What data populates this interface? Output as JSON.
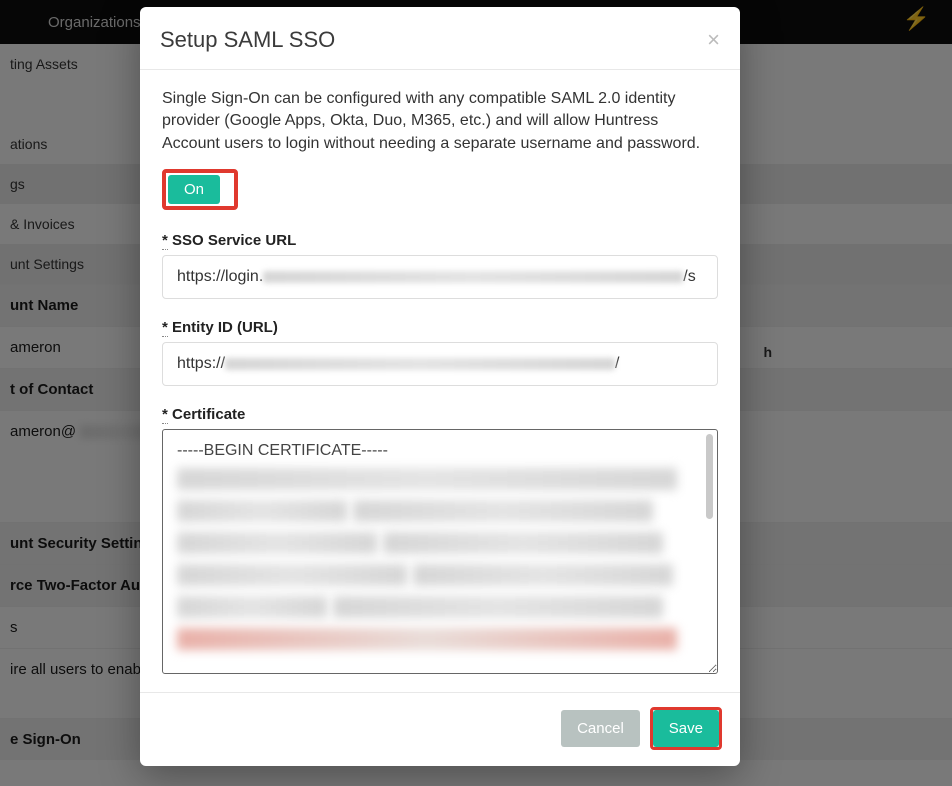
{
  "topnav": {
    "organizations": "Organizations"
  },
  "bg": {
    "side": {
      "assets": "ting Assets",
      "ations": "ations",
      "gs": "gs",
      "billing": " & Invoices",
      "account_settings": "unt Settings"
    },
    "rows": {
      "account_name": "unt Name",
      "ameron": "ameron",
      "contact": "t of Contact",
      "ameron_at": "ameron@",
      "security_settings": "unt Security Settings",
      "two_factor": "rce Two-Factor Auth",
      "s": "s",
      "require_all": "ire all users to enable",
      "single_signon": "e Sign-On"
    },
    "extra_h": "h"
  },
  "modal": {
    "title": "Setup SAML SSO",
    "intro": "Single Sign-On can be configured with any compatible SAML 2.0 identity provider (Google Apps, Okta, Duo, M365, etc.) and will allow Huntress Account users to login without needing a separate username and password.",
    "toggle_label": "On",
    "labels": {
      "sso_url": "SSO Service URL",
      "entity_id": "Entity ID (URL)",
      "certificate": "Certificate"
    },
    "values": {
      "sso_url_prefix": "https://login.",
      "sso_url_suffix": "/s",
      "entity_id_prefix": "https://",
      "entity_id_suffix": "/",
      "cert_begin": "-----BEGIN CERTIFICATE-----"
    },
    "buttons": {
      "cancel": "Cancel",
      "save": "Save"
    }
  }
}
